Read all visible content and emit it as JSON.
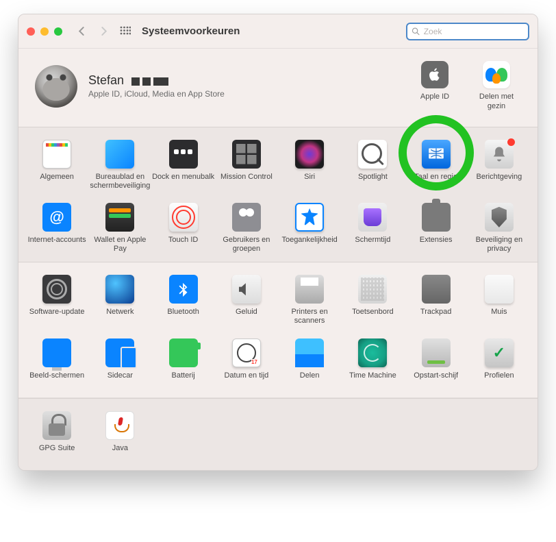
{
  "toolbar": {
    "title": "Systeemvoorkeuren",
    "search_placeholder": "Zoek"
  },
  "user": {
    "name": "Stefan",
    "subtitle": "Apple ID, iCloud, Media en App Store"
  },
  "account_buttons": {
    "apple_id": "Apple ID",
    "family": "Delen met gezin"
  },
  "row1": [
    {
      "id": "algemeen",
      "label": "Algemeen"
    },
    {
      "id": "desktop",
      "label": "Bureaublad en schermbeveiliging"
    },
    {
      "id": "dock",
      "label": "Dock en menubalk"
    },
    {
      "id": "mission",
      "label": "Mission Control"
    },
    {
      "id": "siri",
      "label": "Siri"
    },
    {
      "id": "spotlight",
      "label": "Spotlight"
    },
    {
      "id": "lang",
      "label": "Taal en regio"
    },
    {
      "id": "notif",
      "label": "Berichtgeving"
    }
  ],
  "row2": [
    {
      "id": "internet",
      "label": "Internet-accounts"
    },
    {
      "id": "wallet",
      "label": "Wallet en Apple Pay"
    },
    {
      "id": "touchid",
      "label": "Touch ID"
    },
    {
      "id": "users",
      "label": "Gebruikers en groepen"
    },
    {
      "id": "access",
      "label": "Toegankelijkheid"
    },
    {
      "id": "screentime",
      "label": "Schermtijd"
    },
    {
      "id": "ext",
      "label": "Extensies"
    },
    {
      "id": "security",
      "label": "Beveiliging en privacy"
    }
  ],
  "row3": [
    {
      "id": "update",
      "label": "Software-update"
    },
    {
      "id": "network",
      "label": "Netwerk"
    },
    {
      "id": "bluetooth",
      "label": "Bluetooth"
    },
    {
      "id": "sound",
      "label": "Geluid"
    },
    {
      "id": "printer",
      "label": "Printers en scanners"
    },
    {
      "id": "keyboard",
      "label": "Toetsenbord"
    },
    {
      "id": "trackpad",
      "label": "Trackpad"
    },
    {
      "id": "mouse",
      "label": "Muis"
    }
  ],
  "row4": [
    {
      "id": "display",
      "label": "Beeld-schermen"
    },
    {
      "id": "sidecar",
      "label": "Sidecar"
    },
    {
      "id": "battery",
      "label": "Batterij"
    },
    {
      "id": "datetime",
      "label": "Datum en tijd"
    },
    {
      "id": "share",
      "label": "Delen"
    },
    {
      "id": "timemachine",
      "label": "Time Machine"
    },
    {
      "id": "startup",
      "label": "Opstart-schijf"
    },
    {
      "id": "profiles",
      "label": "Profielen"
    }
  ],
  "row5": [
    {
      "id": "gpg",
      "label": "GPG Suite"
    },
    {
      "id": "java",
      "label": "Java"
    }
  ]
}
